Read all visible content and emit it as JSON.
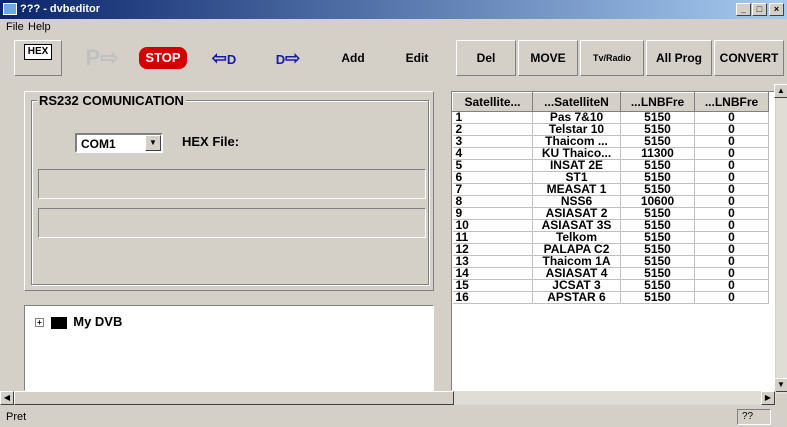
{
  "window": {
    "title": "??? - dvbeditor"
  },
  "menu": {
    "items": [
      "File",
      "Help"
    ]
  },
  "toolbar": {
    "hex_label": "HEX",
    "stop_label": "STOP",
    "d_in_label": "D",
    "d_out_label": "D",
    "buttons": [
      "Add",
      "Edit",
      "Del",
      "MOVE",
      "Tv/Radio",
      "All Prog",
      "CONVERT"
    ]
  },
  "rs232": {
    "title": "RS232 COMUNICATION",
    "port_value": "COM1",
    "hex_file_label": "HEX File:"
  },
  "tree": {
    "root_label": "My DVB"
  },
  "grid": {
    "columns": [
      "Satellite...",
      "...SatelliteN",
      "...LNBFre",
      "...LNBFre"
    ],
    "rows": [
      [
        "1",
        "Pas 7&10",
        "5150",
        "0"
      ],
      [
        "2",
        "Telstar 10",
        "5150",
        "0"
      ],
      [
        "3",
        "Thaicom ...",
        "5150",
        "0"
      ],
      [
        "4",
        "KU Thaico...",
        "11300",
        "0"
      ],
      [
        "5",
        "INSAT 2E",
        "5150",
        "0"
      ],
      [
        "6",
        "ST1",
        "5150",
        "0"
      ],
      [
        "7",
        "MEASAT 1",
        "5150",
        "0"
      ],
      [
        "8",
        "NSS6",
        "10600",
        "0"
      ],
      [
        "9",
        "ASIASAT 2",
        "5150",
        "0"
      ],
      [
        "10",
        "ASIASAT 3S",
        "5150",
        "0"
      ],
      [
        "11",
        "Telkom",
        "5150",
        "0"
      ],
      [
        "12",
        "PALAPA C2",
        "5150",
        "0"
      ],
      [
        "13",
        "Thaicom 1A",
        "5150",
        "0"
      ],
      [
        "14",
        "ASIASAT 4",
        "5150",
        "0"
      ],
      [
        "15",
        "JCSAT 3",
        "5150",
        "0"
      ],
      [
        "16",
        "APSTAR 6",
        "5150",
        "0"
      ]
    ]
  },
  "status": {
    "text": "Pret",
    "pane": "??"
  },
  "colors": {
    "titlebar_start": "#0a246a",
    "titlebar_end": "#a6caf0",
    "stop_red": "#d40000",
    "arrow_blue": "#1a1aa8"
  }
}
